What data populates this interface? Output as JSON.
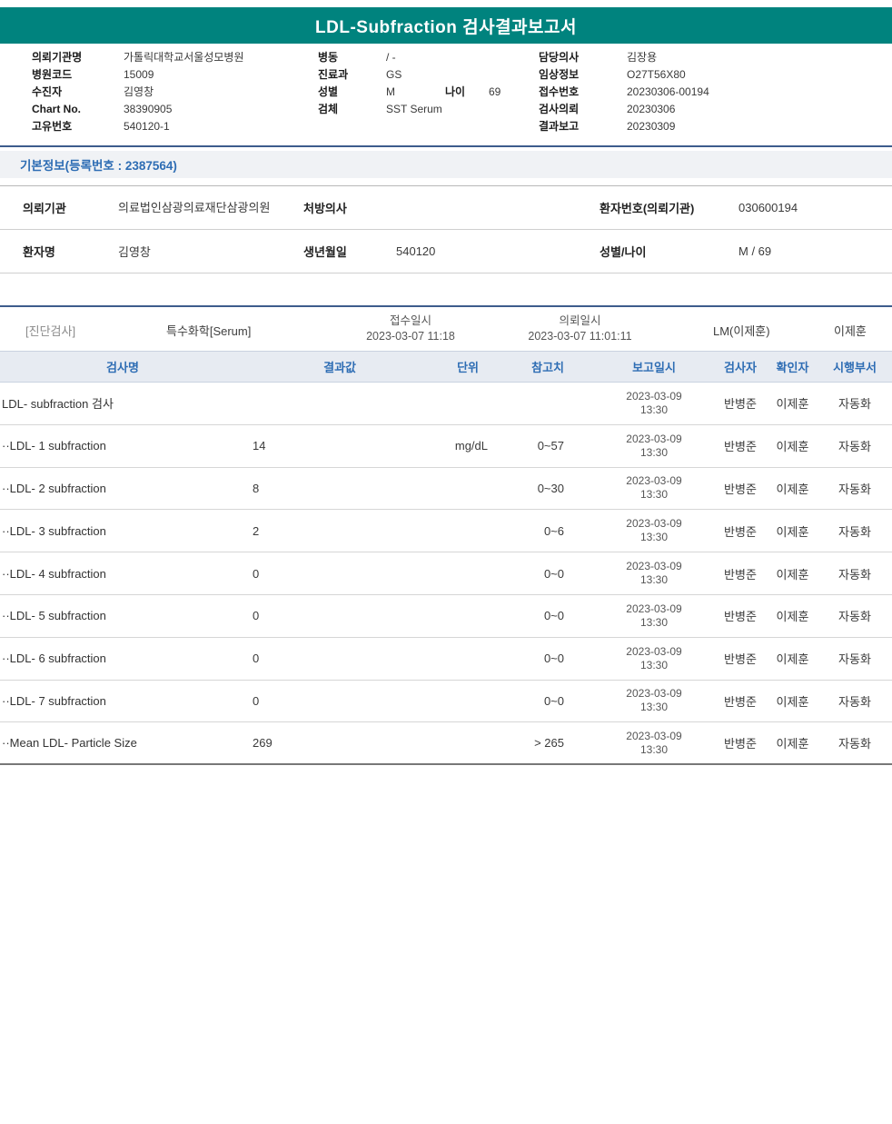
{
  "theme": {
    "brand_teal": "#00837E",
    "accent_blue": "#2E6DB4"
  },
  "title": "LDL-Subfraction 검사결과보고서",
  "patient_header": {
    "col1": [
      {
        "label": "의뢰기관명",
        "value": "가톨릭대학교서울성모병원"
      },
      {
        "label": "병원코드",
        "value": "15009"
      },
      {
        "label": "수진자",
        "value": "김영창"
      },
      {
        "label": "Chart No.",
        "value": "38390905"
      },
      {
        "label": "고유번호",
        "value": "540120-1"
      }
    ],
    "col2": [
      {
        "label": "병동",
        "value": "/ -"
      },
      {
        "label": "진료과",
        "value": "GS"
      },
      {
        "label": "성별",
        "value": "M",
        "extra_label": "나이",
        "extra_value": "69"
      },
      {
        "label": "검체",
        "value": "SST Serum"
      }
    ],
    "col3": [
      {
        "label": "담당의사",
        "value": "김장용"
      },
      {
        "label": "임상정보",
        "value": "O27T56X80"
      },
      {
        "label": "접수번호",
        "value": "20230306-00194"
      },
      {
        "label": "검사의뢰",
        "value": "20230306"
      },
      {
        "label": "결과보고",
        "value": "20230309"
      }
    ]
  },
  "basic_info": {
    "title": "기본정보(등록번호 : 2387564)",
    "rows": [
      {
        "c1_label": "의뢰기관",
        "c1_value": "의료법인삼광의료재단삼광의원",
        "c2_label": "처방의사",
        "c2_value": "",
        "c3_label": "환자번호(의뢰기관)",
        "c3_value": "030600194"
      },
      {
        "c1_label": "환자명",
        "c1_value": "김영창",
        "c2_label": "생년월일",
        "c2_value": "540120",
        "c3_label": "성별/나이",
        "c3_value": "M / 69"
      }
    ]
  },
  "results": {
    "meta": {
      "category": "[진단검사]",
      "group": "특수화학[Serum]",
      "receipt_label": "접수일시",
      "receipt_value": "2023-03-07 11:18",
      "request_label": "의뢰일시",
      "request_value": "2023-03-07 11:01:11",
      "lm": "LM(이제훈)",
      "confirmer": "이제훈"
    },
    "columns": [
      "검사명",
      "결과값",
      "단위",
      "참고치",
      "보고일시",
      "검사자",
      "확인자",
      "시행부서"
    ],
    "rows": [
      {
        "name": "LDL- subfraction 검사",
        "result": "",
        "unit": "",
        "ref": "",
        "date": "2023-03-09",
        "time": "13:30",
        "tester": "반병준",
        "checker": "이제훈",
        "dept": "자동화"
      },
      {
        "name": "··LDL- 1 subfraction",
        "result": "14",
        "unit": "mg/dL",
        "ref": "0~57",
        "date": "2023-03-09",
        "time": "13:30",
        "tester": "반병준",
        "checker": "이제훈",
        "dept": "자동화"
      },
      {
        "name": "··LDL- 2 subfraction",
        "result": "8",
        "unit": "",
        "ref": "0~30",
        "date": "2023-03-09",
        "time": "13:30",
        "tester": "반병준",
        "checker": "이제훈",
        "dept": "자동화"
      },
      {
        "name": "··LDL- 3 subfraction",
        "result": "2",
        "unit": "",
        "ref": "0~6",
        "date": "2023-03-09",
        "time": "13:30",
        "tester": "반병준",
        "checker": "이제훈",
        "dept": "자동화"
      },
      {
        "name": "··LDL- 4 subfraction",
        "result": "0",
        "unit": "",
        "ref": "0~0",
        "date": "2023-03-09",
        "time": "13:30",
        "tester": "반병준",
        "checker": "이제훈",
        "dept": "자동화"
      },
      {
        "name": "··LDL- 5 subfraction",
        "result": "0",
        "unit": "",
        "ref": "0~0",
        "date": "2023-03-09",
        "time": "13:30",
        "tester": "반병준",
        "checker": "이제훈",
        "dept": "자동화"
      },
      {
        "name": "··LDL- 6 subfraction",
        "result": "0",
        "unit": "",
        "ref": "0~0",
        "date": "2023-03-09",
        "time": "13:30",
        "tester": "반병준",
        "checker": "이제훈",
        "dept": "자동화"
      },
      {
        "name": "··LDL- 7 subfraction",
        "result": "0",
        "unit": "",
        "ref": "0~0",
        "date": "2023-03-09",
        "time": "13:30",
        "tester": "반병준",
        "checker": "이제훈",
        "dept": "자동화"
      },
      {
        "name": "··Mean LDL- Particle Size",
        "result": "269",
        "unit": "",
        "ref": "> 265",
        "date": "2023-03-09",
        "time": "13:30",
        "tester": "반병준",
        "checker": "이제훈",
        "dept": "자동화"
      }
    ]
  }
}
